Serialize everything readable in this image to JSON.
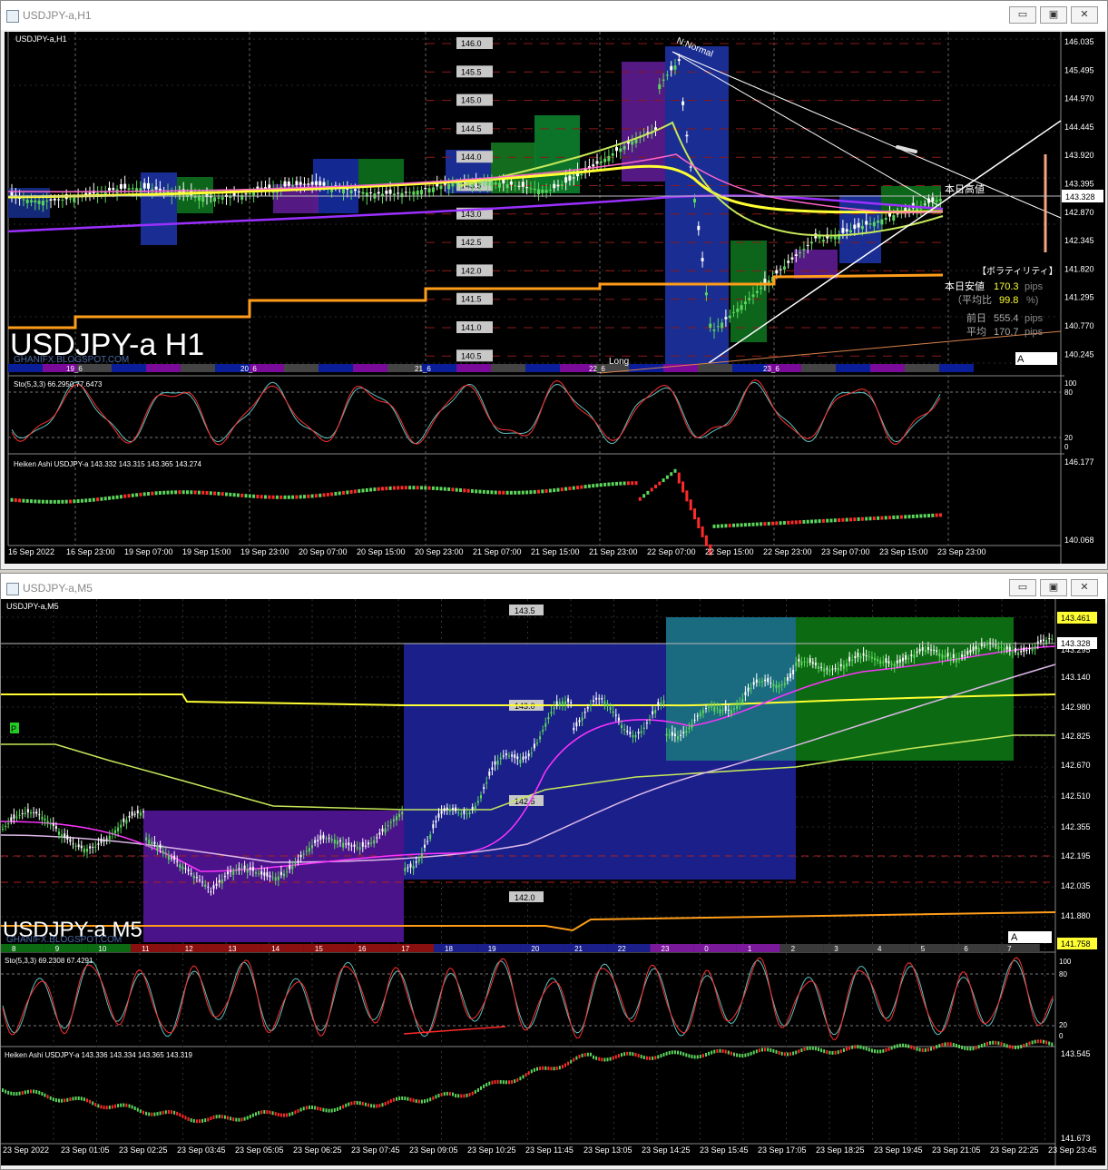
{
  "window_top": {
    "title": "USDJPY-a,H1",
    "buttons": {
      "minimize": "▭",
      "restore": "▣",
      "close": "✕"
    },
    "main_label": "USDJPY-a,H1",
    "watermark": "USDJPY-a H1",
    "watermark_sub": "GHANIFX.BLOGSPOT.COM",
    "price_axis": [
      "146.035",
      "145.495",
      "144.970",
      "144.445",
      "143.920",
      "143.395",
      "142.870",
      "142.345",
      "141.820",
      "141.295",
      "140.770",
      "140.245"
    ],
    "current_price": "143.328",
    "round_levels": [
      "146.0",
      "145.5",
      "145.0",
      "144.5",
      "144.0",
      "143.5",
      "143.0",
      "142.5",
      "142.0",
      "141.5",
      "141.0",
      "140.5"
    ],
    "annotations": {
      "n_normal": "N:Normal",
      "long": "Long",
      "today_high": "本日高値",
      "box_a": "A"
    },
    "volatility": {
      "header": "【ボラティリティ】",
      "row1_label": "本日安値",
      "row1_value": "170.3",
      "row1_unit": "pips",
      "row2_label": "（平均比",
      "row2_value": "99.8",
      "row2_unit": "%)",
      "row3_label": "前日",
      "row3_value": "555.4",
      "row3_unit": "pips",
      "row4_label": "平均",
      "row4_value": "170.7",
      "row4_unit": "pips"
    },
    "day_labels": [
      "19_6",
      "20_6",
      "21_6",
      "22_6",
      "23_6"
    ],
    "stoch_label": "Sto(5,3,3) 66.2950 77.6473",
    "stoch_axis": [
      "100",
      "80",
      "20",
      "0"
    ],
    "heiken_label": "Heiken Ashi USDJPY-a 143.332 143.315 143.365 143.274",
    "heiken_axis": [
      "146.177",
      "140.068"
    ],
    "time_axis": [
      "16 Sep 2022",
      "16 Sep 23:00",
      "19 Sep 07:00",
      "19 Sep 15:00",
      "19 Sep 23:00",
      "20 Sep 07:00",
      "20 Sep 15:00",
      "20 Sep 23:00",
      "21 Sep 07:00",
      "21 Sep 15:00",
      "21 Sep 23:00",
      "22 Sep 07:00",
      "22 Sep 15:00",
      "22 Sep 23:00",
      "23 Sep 07:00",
      "23 Sep 15:00",
      "23 Sep 23:00"
    ]
  },
  "window_bottom": {
    "title": "USDJPY-a,M5",
    "buttons": {
      "minimize": "▭",
      "restore": "▣",
      "close": "✕"
    },
    "main_label": "USDJPY-a,M5",
    "watermark": "USDJPY-a M5",
    "watermark_sub": "GHANIFX.BLOGSPOT.COM",
    "price_axis": [
      "143.295",
      "143.140",
      "142.980",
      "142.825",
      "142.670",
      "142.510",
      "142.355",
      "142.195",
      "142.035",
      "141.880"
    ],
    "badge_high": "143.461",
    "current_price": "143.328",
    "badge_low": "141.758",
    "round_levels": [
      "143.5",
      "143.0",
      "142.5",
      "142.0"
    ],
    "hour_labels": [
      "8",
      "9",
      "10",
      "11",
      "12",
      "13",
      "14",
      "15",
      "16",
      "17",
      "18",
      "19",
      "20",
      "21",
      "22",
      "23",
      "0",
      "1",
      "2",
      "3",
      "4",
      "5",
      "6",
      "7"
    ],
    "p_marker": "P",
    "box_a": "A",
    "stoch_label": "Sto(5,3,3) 69.2308 67.4291",
    "stoch_axis": [
      "100",
      "80",
      "20",
      "0"
    ],
    "heiken_label": "Heiken Ashi USDJPY-a 143.336 143.334 143.365 143.319",
    "heiken_axis": [
      "143.545",
      "141.673"
    ],
    "time_axis": [
      "23 Sep 2022",
      "23 Sep 01:05",
      "23 Sep 02:25",
      "23 Sep 03:45",
      "23 Sep 05:05",
      "23 Sep 06:25",
      "23 Sep 07:45",
      "23 Sep 09:05",
      "23 Sep 10:25",
      "23 Sep 11:45",
      "23 Sep 13:05",
      "23 Sep 14:25",
      "23 Sep 15:45",
      "23 Sep 17:05",
      "23 Sep 18:25",
      "23 Sep 19:45",
      "23 Sep 21:05",
      "23 Sep 22:25",
      "23 Sep 23:45"
    ]
  },
  "colors": {
    "up": "#5cd65c",
    "down": "#ff2a2a",
    "ma_yellow": "#ffff33",
    "ma_orange": "#ff9d1a",
    "ma_purple": "#9b30ff",
    "ma_lime": "#c6e85a",
    "ma_pink": "#ff66cc"
  }
}
